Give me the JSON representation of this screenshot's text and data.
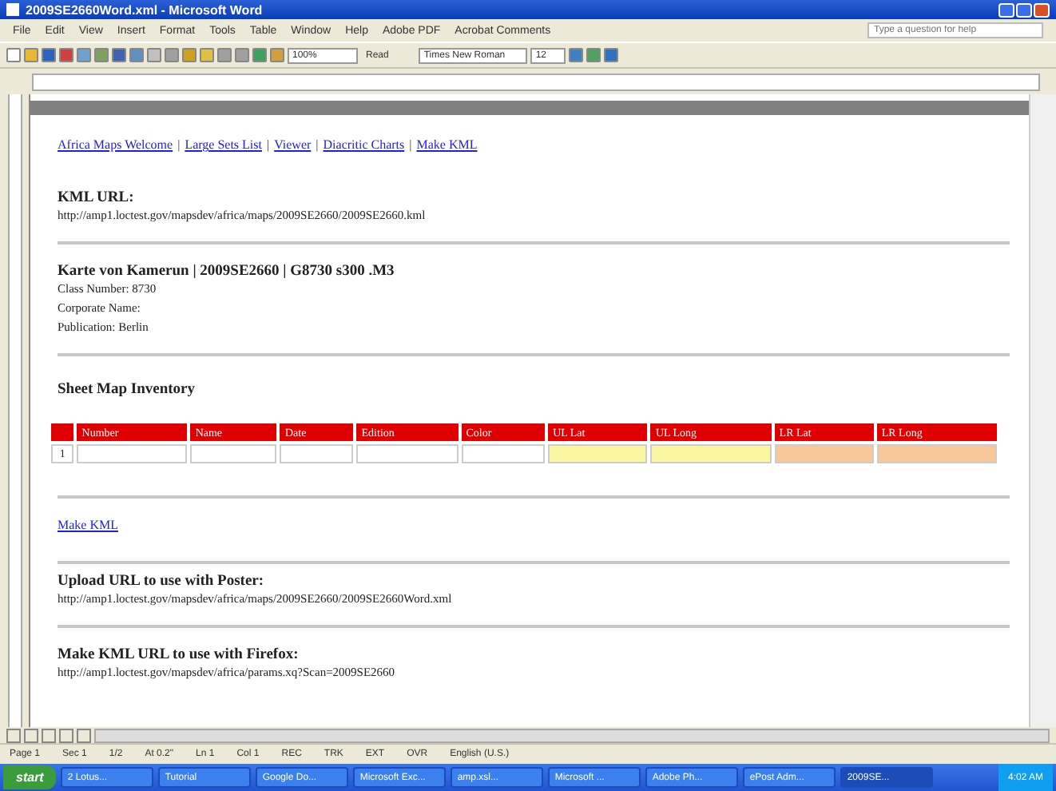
{
  "window": {
    "title": "2009SE2660Word.xml - Microsoft Word"
  },
  "menu": [
    "File",
    "Edit",
    "View",
    "Insert",
    "Format",
    "Tools",
    "Table",
    "Window",
    "Help",
    "Adobe PDF",
    "Acrobat Comments"
  ],
  "help_box": {
    "placeholder": "Type a question for help"
  },
  "toolbar": {
    "zoom": "100%",
    "read": "Read",
    "font": "Times New Roman",
    "size": "12"
  },
  "nav_separator": "|",
  "nav_links": [
    "Africa Maps Welcome",
    "Large Sets List",
    "Viewer",
    "Diacritic Charts",
    "Make KML"
  ],
  "kml_section": {
    "heading": "KML URL:",
    "url": "http://amp1.loctest.gov/mapsdev/africa/maps/2009SE2660/2009SE2660.kml"
  },
  "record": {
    "heading": "Karte von Kamerun | 2009SE2660 | G8730 s300 .M3",
    "lines": [
      "Class Number: 8730",
      "Corporate Name:",
      "Publication: Berlin"
    ]
  },
  "inventory": {
    "heading": "Sheet Map Inventory",
    "columns": [
      {
        "color": "#ffffff"
      },
      {
        "label": "Number",
        "color": "#ffffff"
      },
      {
        "label": "Name",
        "color": "#ffffff"
      },
      {
        "label": "Date",
        "color": "#ffffff"
      },
      {
        "label": "Edition",
        "color": "#ffffff"
      },
      {
        "label": "Color",
        "color": "#ffffff"
      },
      {
        "label": "UL Lat",
        "color": "#fbf7a0"
      },
      {
        "label": "UL Long",
        "color": "#fbf7a0"
      },
      {
        "label": "LR Lat",
        "color": "#f9c89a"
      },
      {
        "label": "LR Long",
        "color": "#f9c89a"
      }
    ],
    "rows": [
      [
        "1",
        "",
        "",
        "",
        "",
        "",
        "",
        "",
        "",
        ""
      ]
    ]
  },
  "make_kml_link": "Make KML",
  "poster_section": {
    "heading": "Upload URL to use with Poster:",
    "url": "http://amp1.loctest.gov/mapsdev/africa/maps/2009SE2660/2009SE2660Word.xml"
  },
  "firefox_section": {
    "heading": "Make KML URL to use with Firefox:",
    "url": "http://amp1.loctest.gov/mapsdev/africa/params.xq?Scan=2009SE2660"
  },
  "status_bar": [
    "Page 1",
    "Sec 1",
    "1/2",
    "At 0.2\"",
    "Ln 1",
    "Col 1",
    "REC",
    "TRK",
    "EXT",
    "OVR",
    "English (U.S.)"
  ],
  "taskbar": {
    "start": "start",
    "items": [
      {
        "label": "2 Lotus...",
        "selected": false
      },
      {
        "label": "Tutorial",
        "selected": false
      },
      {
        "label": "Google Do...",
        "selected": false
      },
      {
        "label": "Microsoft Exc...",
        "selected": false
      },
      {
        "label": "amp.xsl...",
        "selected": false
      },
      {
        "label": "Microsoft ...",
        "selected": false
      },
      {
        "label": "Adobe Ph...",
        "selected": false
      },
      {
        "label": "ePost Adm...",
        "selected": false
      },
      {
        "label": "2009SE...",
        "selected": true
      }
    ],
    "clock": "4:02 AM"
  }
}
